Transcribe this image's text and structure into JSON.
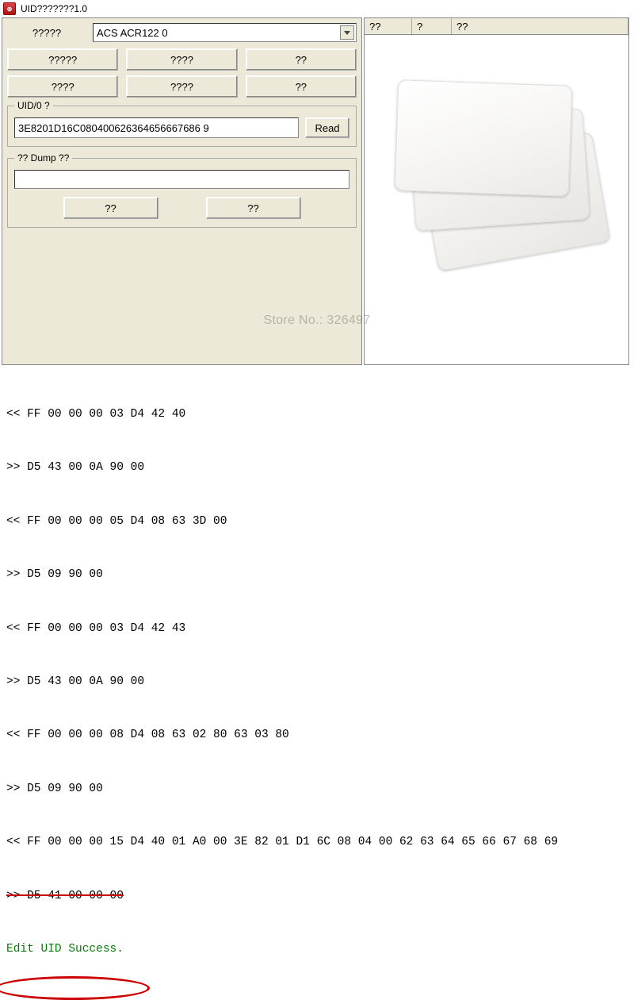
{
  "window": {
    "title": "UID???????1.0"
  },
  "left": {
    "device_label": "?????",
    "device_value": "ACS ACR122 0",
    "buttons": [
      "?????",
      "????",
      "??",
      "????",
      "????",
      "??"
    ]
  },
  "uid_group": {
    "legend": "UID/0 ?",
    "value": "3E8201D16C080400626364656667686 9",
    "read_btn": "Read"
  },
  "dump_group": {
    "legend": "?? Dump ??",
    "path": "",
    "btn_a": "??",
    "btn_b": "??"
  },
  "columns": {
    "c1": "??",
    "c2": "?",
    "c3": "??"
  },
  "log_lines": [
    "<< FF 00 00 00 03 D4 42 40",
    ">> D5 43 00 0A 90 00",
    "<< FF 00 00 00 05 D4 08 63 3D 00",
    ">> D5 09 90 00",
    "<< FF 00 00 00 03 D4 42 43",
    ">> D5 43 00 0A 90 00",
    "<< FF 00 00 00 08 D4 08 63 02 80 63 03 80",
    ">> D5 09 90 00",
    "<< FF 00 00 00 15 D4 40 01 A0 00 3E 82 01 D1 6C 08 04 00 62 63 64 65 66 67 68 69"
  ],
  "log_strike": ">> D5 41 00 00 00",
  "log_success": "Edit UID Success.",
  "watermark": "Store No.: 326497"
}
